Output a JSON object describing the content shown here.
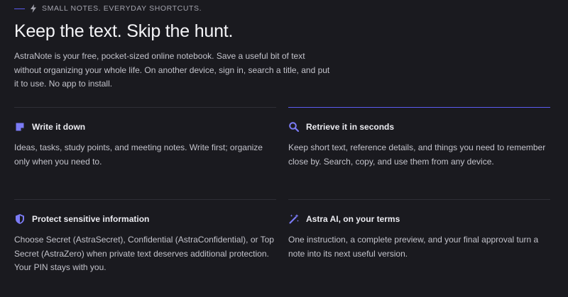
{
  "eyebrow": {
    "text": "SMALL NOTES. EVERYDAY SHORTCUTS.",
    "icon": "bolt-icon"
  },
  "hero": {
    "title": "Keep the text. Skip the hunt.",
    "lead": "AstraNote is your free, pocket-sized online notebook. Save a useful bit of text without organizing your whole life. On another device, sign in, search a title, and put it to use. No app to install."
  },
  "features": [
    {
      "icon": "note-icon",
      "title": "Write it down",
      "body": "Ideas, tasks, study points, and meeting notes. Write first; organize only when you need to."
    },
    {
      "icon": "search-icon",
      "title": "Retrieve it in seconds",
      "body": "Keep short text, reference details, and things you need to remember close by. Search, copy, and use them from any device."
    },
    {
      "icon": "shield-icon",
      "title": "Protect sensitive information",
      "body": "Choose Secret (AstraSecret), Confidential (AstraConfidential), or Top Secret (AstraZero) when private text deserves additional protection. Your PIN stays with you."
    },
    {
      "icon": "magic-wand-icon",
      "title": "Astra AI, on your terms",
      "body": "One instruction, a complete preview, and your final approval turn a note into its next useful version."
    }
  ],
  "colors": {
    "accent": "#5b5bf0",
    "background": "#1a1a1f",
    "icon": "#7b7bf5"
  }
}
